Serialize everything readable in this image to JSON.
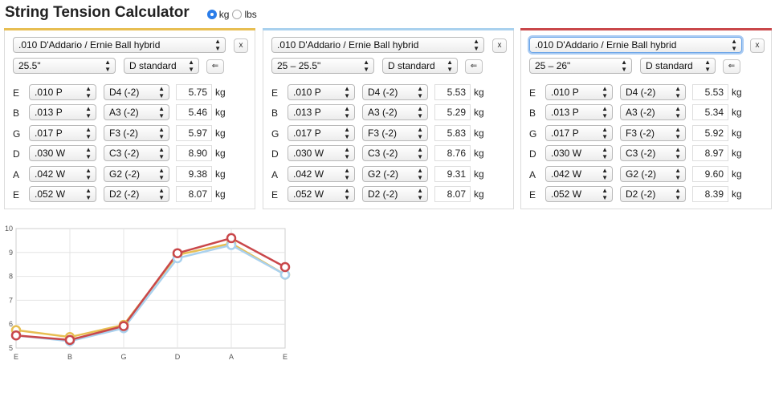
{
  "title": "String Tension Calculator",
  "units": {
    "options": [
      "kg",
      "lbs"
    ],
    "selected": "kg"
  },
  "colors": {
    "panel1": "#e7be52",
    "panel2": "#a9d1ee",
    "panel3": "#c9474a"
  },
  "remove_label": "x",
  "reverse_label": "⇐",
  "panels": [
    {
      "set": ".010 D'Addario / Ernie Ball hybrid",
      "scale": "25.5\"",
      "tuning": "D standard",
      "strings": [
        {
          "note": "E",
          "gauge": ".010 P",
          "pitch": "D4 (-2)",
          "tension": "5.75",
          "unit": "kg"
        },
        {
          "note": "B",
          "gauge": ".013 P",
          "pitch": "A3 (-2)",
          "tension": "5.46",
          "unit": "kg"
        },
        {
          "note": "G",
          "gauge": ".017 P",
          "pitch": "F3 (-2)",
          "tension": "5.97",
          "unit": "kg"
        },
        {
          "note": "D",
          "gauge": ".030 W",
          "pitch": "C3 (-2)",
          "tension": "8.90",
          "unit": "kg"
        },
        {
          "note": "A",
          "gauge": ".042 W",
          "pitch": "G2 (-2)",
          "tension": "9.38",
          "unit": "kg"
        },
        {
          "note": "E",
          "gauge": ".052 W",
          "pitch": "D2 (-2)",
          "tension": "8.07",
          "unit": "kg"
        }
      ]
    },
    {
      "set": ".010 D'Addario / Ernie Ball hybrid",
      "scale": "25 – 25.5\"",
      "tuning": "D standard",
      "strings": [
        {
          "note": "E",
          "gauge": ".010 P",
          "pitch": "D4 (-2)",
          "tension": "5.53",
          "unit": "kg"
        },
        {
          "note": "B",
          "gauge": ".013 P",
          "pitch": "A3 (-2)",
          "tension": "5.29",
          "unit": "kg"
        },
        {
          "note": "G",
          "gauge": ".017 P",
          "pitch": "F3 (-2)",
          "tension": "5.83",
          "unit": "kg"
        },
        {
          "note": "D",
          "gauge": ".030 W",
          "pitch": "C3 (-2)",
          "tension": "8.76",
          "unit": "kg"
        },
        {
          "note": "A",
          "gauge": ".042 W",
          "pitch": "G2 (-2)",
          "tension": "9.31",
          "unit": "kg"
        },
        {
          "note": "E",
          "gauge": ".052 W",
          "pitch": "D2 (-2)",
          "tension": "8.07",
          "unit": "kg"
        }
      ]
    },
    {
      "set": ".010 D'Addario / Ernie Ball hybrid",
      "scale": "25 – 26\"",
      "tuning": "D standard",
      "strings": [
        {
          "note": "E",
          "gauge": ".010 P",
          "pitch": "D4 (-2)",
          "tension": "5.53",
          "unit": "kg"
        },
        {
          "note": "B",
          "gauge": ".013 P",
          "pitch": "A3 (-2)",
          "tension": "5.34",
          "unit": "kg"
        },
        {
          "note": "G",
          "gauge": ".017 P",
          "pitch": "F3 (-2)",
          "tension": "5.92",
          "unit": "kg"
        },
        {
          "note": "D",
          "gauge": ".030 W",
          "pitch": "C3 (-2)",
          "tension": "8.97",
          "unit": "kg"
        },
        {
          "note": "A",
          "gauge": ".042 W",
          "pitch": "G2 (-2)",
          "tension": "9.60",
          "unit": "kg"
        },
        {
          "note": "E",
          "gauge": ".052 W",
          "pitch": "D2 (-2)",
          "tension": "8.39",
          "unit": "kg"
        }
      ]
    }
  ],
  "chart_data": {
    "type": "line",
    "categories": [
      "E",
      "B",
      "G",
      "D",
      "A",
      "E"
    ],
    "ylim": [
      5,
      10
    ],
    "yticks": [
      5,
      6,
      7,
      8,
      9,
      10
    ],
    "grid": true,
    "series": [
      {
        "color": "#e7be52",
        "values": [
          5.75,
          5.46,
          5.97,
          8.9,
          9.38,
          8.07
        ]
      },
      {
        "color": "#a9d1ee",
        "values": [
          5.53,
          5.29,
          5.83,
          8.76,
          9.31,
          8.07
        ]
      },
      {
        "color": "#c9474a",
        "values": [
          5.53,
          5.34,
          5.92,
          8.97,
          9.6,
          8.39
        ]
      }
    ]
  }
}
